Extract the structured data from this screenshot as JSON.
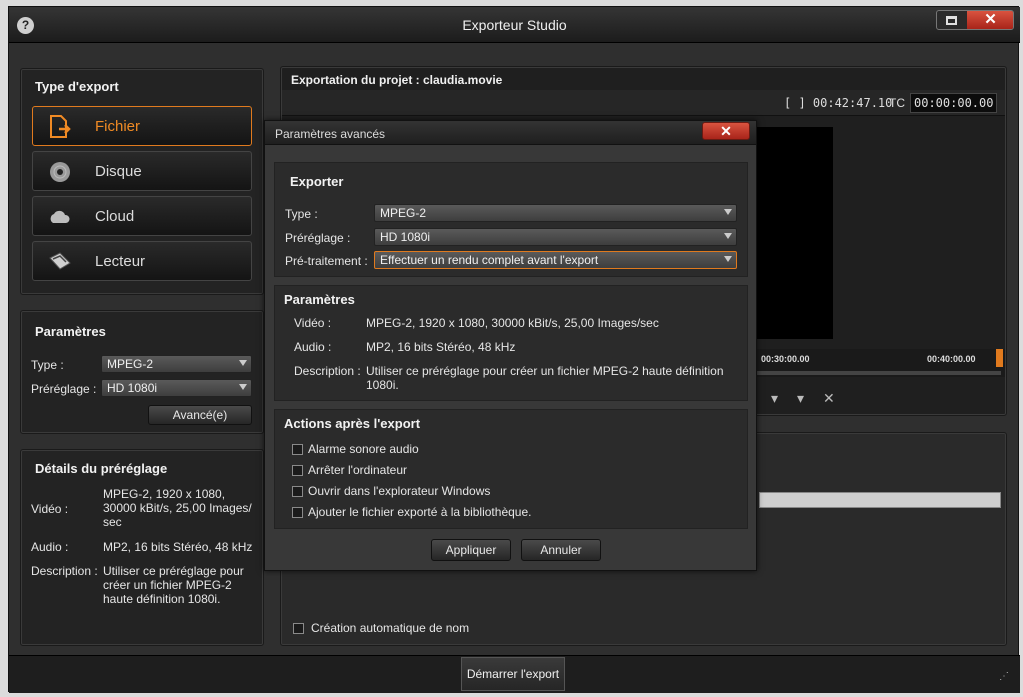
{
  "window": {
    "title": "Exporteur Studio",
    "help_icon": "question-mark",
    "close_glyph": "✕"
  },
  "export_type": {
    "title": "Type d'export",
    "items": [
      {
        "label": "Fichier",
        "icon": "file-export-icon",
        "active": true
      },
      {
        "label": "Disque",
        "icon": "disc-icon",
        "active": false
      },
      {
        "label": "Cloud",
        "icon": "cloud-icon",
        "active": false
      },
      {
        "label": "Lecteur",
        "icon": "device-icon",
        "active": false
      }
    ]
  },
  "params_left": {
    "title": "Paramètres",
    "type_label": "Type :",
    "type_value": "MPEG-2",
    "preset_label": "Préréglage :",
    "preset_value": "HD 1080i",
    "advanced_button": "Avancé(e)"
  },
  "preset_details": {
    "title": "Détails du préréglage",
    "video_label": "Vidéo :",
    "video_lines": [
      "MPEG-2, 1920 x 1080,",
      "30000 kBit/s, 25,00 Images/",
      "sec"
    ],
    "audio_label": "Audio :",
    "audio_value": "MP2, 16 bits Stéréo, 48 kHz",
    "description_label": "Description :",
    "description_lines": [
      "Utiliser ce préréglage pour",
      "créer un fichier MPEG-2",
      "haute définition 1080i."
    ]
  },
  "project": {
    "title": "Exportation du projet : claudia.movie",
    "duration": "[ ] 00:42:47.10",
    "tc_label": "TC",
    "tc_value": "00:00:00.00",
    "ruler_labels": [
      "00:30:00.00",
      "00:40:00.00"
    ]
  },
  "auto_name": {
    "label": "Création automatique de nom"
  },
  "start_button": "Démarrer l'export",
  "dialog": {
    "title": "Paramètres avancés",
    "close_glyph": "✕",
    "export_section": {
      "title": "Exporter",
      "type_label": "Type :",
      "type_value": "MPEG-2",
      "preset_label": "Préréglage :",
      "preset_value": "HD 1080i",
      "pre_label": "Pré-traitement :",
      "pre_value": "Effectuer un rendu complet avant l'export"
    },
    "params_section": {
      "title": "Paramètres",
      "video_label": "Vidéo :",
      "video_value": "MPEG-2, 1920 x 1080, 30000 kBit/s, 25,00 Images/sec",
      "audio_label": "Audio :",
      "audio_value": "MP2, 16 bits Stéréo, 48 kHz",
      "description_label": "Description :",
      "description_lines": [
        "Utiliser ce préréglage pour créer un fichier MPEG-2 haute définition",
        "1080i."
      ]
    },
    "actions_section": {
      "title": "Actions après l'export",
      "options": [
        "Alarme sonore audio",
        "Arrêter l'ordinateur",
        "Ouvrir dans l'explorateur Windows",
        "Ajouter le fichier exporté à la bibliothèque."
      ]
    },
    "apply_button": "Appliquer",
    "cancel_button": "Annuler"
  },
  "colors": {
    "accent": "#f08a24",
    "close": "#c0392b",
    "background": "#2f2f2f"
  }
}
